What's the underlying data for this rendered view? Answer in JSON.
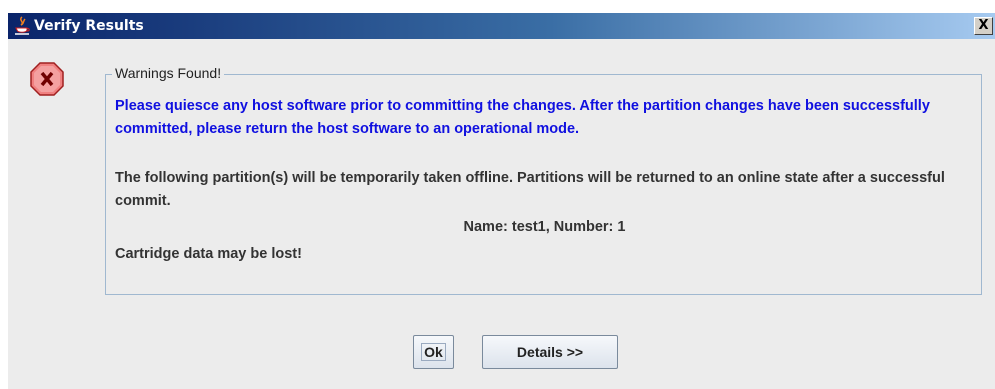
{
  "window": {
    "title": "Verify Results",
    "close_label": "X"
  },
  "group": {
    "title": "Warnings Found!"
  },
  "messages": {
    "blue_text": "Please quiesce any host software prior to committing the changes. After the partition changes have been successfully committed, please return the host software to an operational mode.",
    "offline_text": "The following partition(s) will be temporarily taken offline. Partitions will be returned to an online state after a successful commit.",
    "partition_info": "Name: test1,  Number: 1",
    "data_warning": "Cartridge data may be lost!"
  },
  "buttons": {
    "ok_label": "Ok",
    "details_label": "Details >>"
  },
  "icons": {
    "title_icon": "java-icon",
    "error_icon": "error-stop-icon"
  },
  "colors": {
    "message_blue": "#1010e0",
    "title_bar": "#0a246a"
  }
}
